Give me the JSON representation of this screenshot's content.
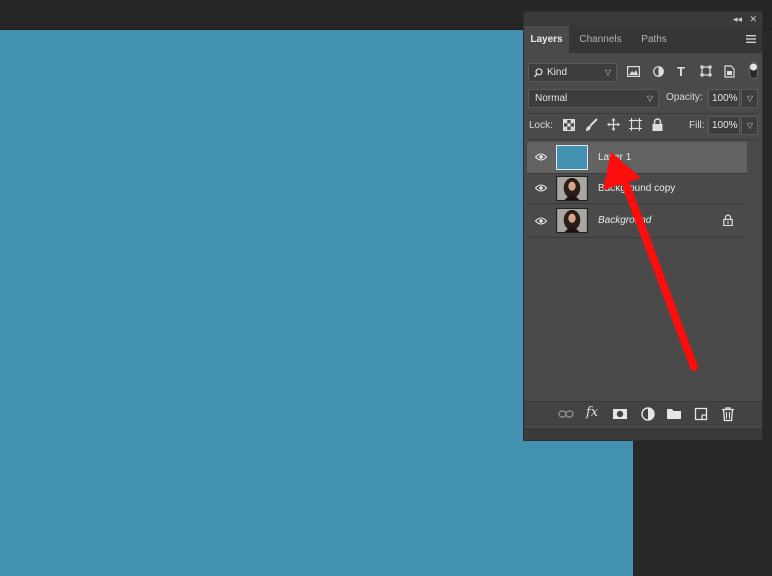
{
  "panel": {
    "tabs": [
      "Layers",
      "Channels",
      "Paths"
    ],
    "filter_kind": "Kind",
    "blend_mode": "Normal",
    "opacity_label": "Opacity:",
    "opacity_value": "100%",
    "lock_label": "Lock:",
    "fill_label": "Fill:",
    "fill_value": "100%",
    "layers": [
      {
        "name": "Layer 1",
        "thumb": "solid-blue",
        "selected": true,
        "locked": false,
        "italic": false
      },
      {
        "name": "Background copy",
        "thumb": "portrait",
        "selected": false,
        "locked": false,
        "italic": false
      },
      {
        "name": "Background",
        "thumb": "portrait",
        "selected": false,
        "locked": true,
        "italic": true
      }
    ],
    "bottom_icons": [
      "link-icon",
      "fx-icon",
      "mask-icon",
      "adjustment-icon",
      "folder-icon",
      "new-layer-icon",
      "trash-icon"
    ]
  },
  "colors": {
    "canvas": "#4291b1",
    "panel_bg": "#4a4a4a",
    "selected_row": "#626262",
    "annotation_arrow": "#ff0d0d"
  }
}
